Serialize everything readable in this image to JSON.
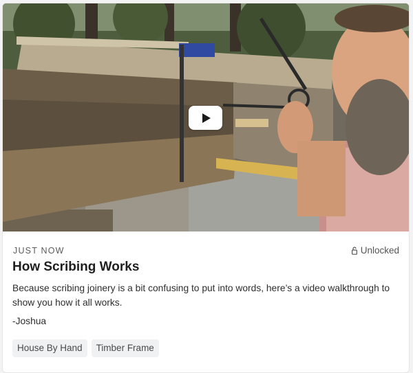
{
  "post": {
    "time": "JUST NOW",
    "access": "Unlocked",
    "title": "How Scribing Works",
    "description": "Because scribing joinery is a bit confusing to put into words, here’s a video walkthrough to show you how it all works.",
    "signature": "-Joshua",
    "tags": [
      "House By Hand",
      "Timber Frame"
    ]
  },
  "video": {
    "play_icon": "play-icon"
  },
  "icons": {
    "lock": "lock-open-icon"
  }
}
